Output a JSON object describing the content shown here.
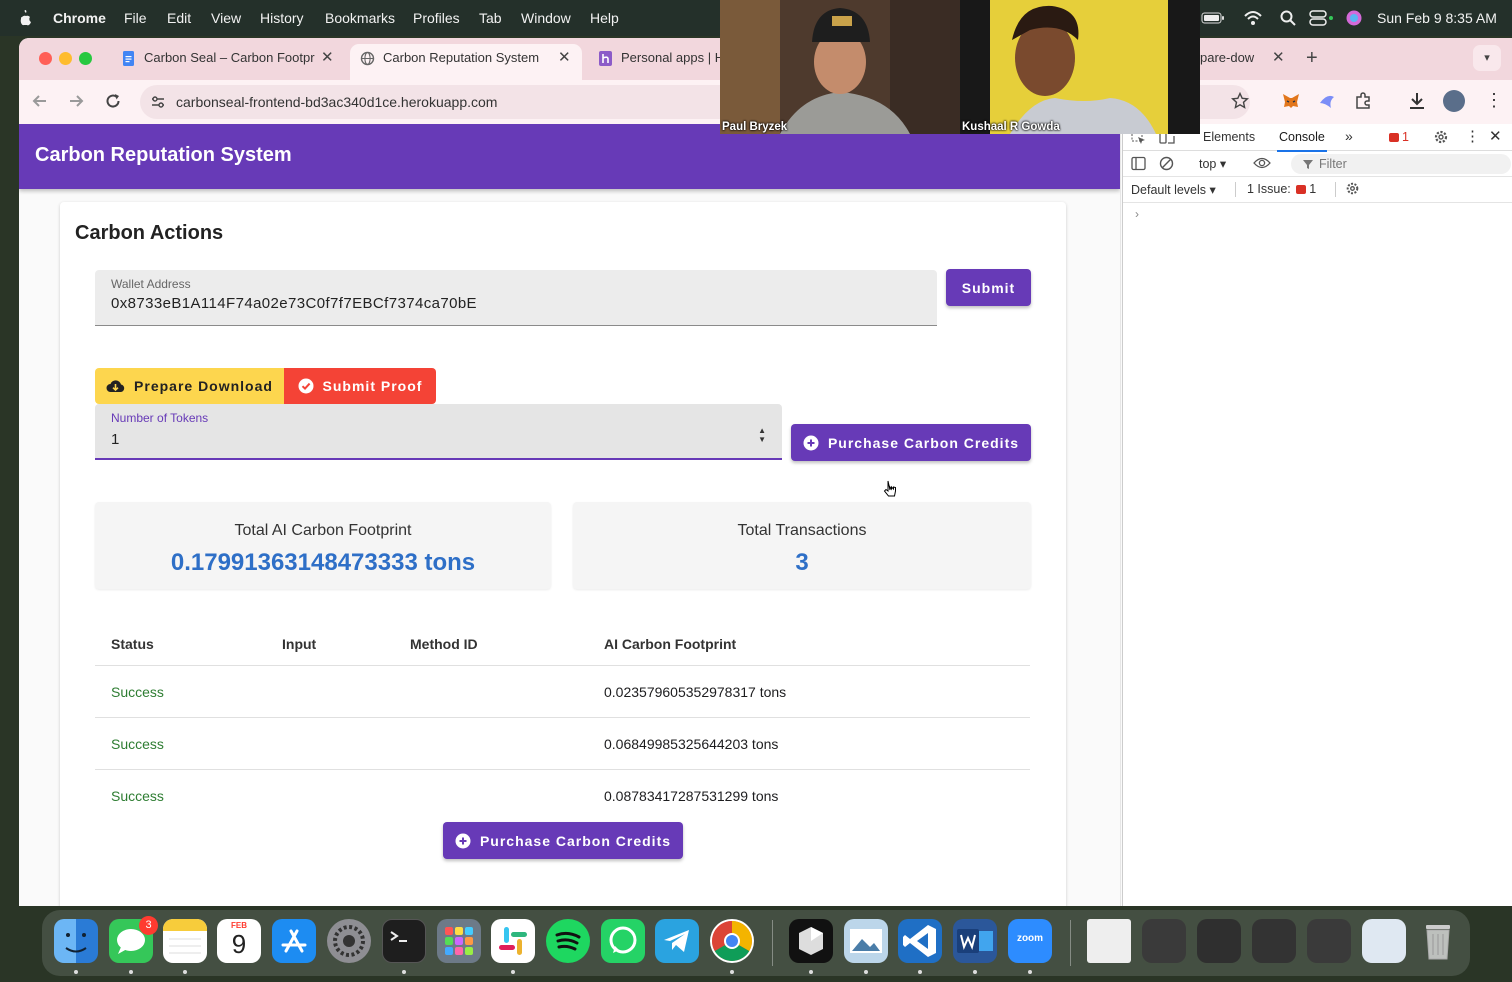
{
  "menubar": {
    "app": "Chrome",
    "items": [
      "File",
      "Edit",
      "View",
      "History",
      "Bookmarks",
      "Profiles",
      "Tab",
      "Window",
      "Help"
    ],
    "clock": "Sun Feb 9  8:35 AM"
  },
  "browser": {
    "tabs": [
      {
        "title": "Carbon Seal – Carbon Footpr",
        "active": false
      },
      {
        "title": "Carbon Reputation System",
        "active": true
      },
      {
        "title": "Personal apps | He",
        "active": false
      },
      {
        "title": "pare-dow",
        "active": false
      }
    ],
    "url": "carbonseal-frontend-bd3ac340d1ce.herokuapp.com"
  },
  "app": {
    "title": "Carbon Reputation System",
    "section_title": "Carbon Actions",
    "wallet": {
      "label": "Wallet Address",
      "value": "0x8733eB1A114F74a02e73C0f7f7EBCf7374ca70bE"
    },
    "submit_label": "Submit",
    "prepare_download_label": "Prepare Download",
    "submit_proof_label": "Submit Proof",
    "tokens": {
      "label": "Number of Tokens",
      "value": "1"
    },
    "purchase_label": "Purchase Carbon Credits",
    "stats": {
      "footprint_label": "Total AI Carbon Footprint",
      "footprint_value": "0.17991363148473333 tons",
      "transactions_label": "Total Transactions",
      "transactions_value": "3"
    },
    "table": {
      "headers": [
        "Status",
        "Input",
        "Method ID",
        "AI Carbon Footprint"
      ],
      "rows": [
        {
          "status": "Success",
          "input": "",
          "method_id": "",
          "footprint": "0.023579605352978317 tons"
        },
        {
          "status": "Success",
          "input": "",
          "method_id": "",
          "footprint": "0.06849985325644203 tons"
        },
        {
          "status": "Success",
          "input": "",
          "method_id": "",
          "footprint": "0.08783417287531299 tons"
        }
      ]
    },
    "bottom_purchase_label": "Purchase Carbon Credits"
  },
  "devtools": {
    "tabs": [
      "Elements",
      "Console"
    ],
    "error_count": "1",
    "context": "top",
    "filter_placeholder": "Filter",
    "levels": "Default levels",
    "issues_label": "1 Issue:",
    "issues_count": "1"
  },
  "video_call": {
    "participants": [
      "Paul Bryzek",
      "Kushaal R Gowda"
    ]
  },
  "dock": {
    "messages_badge": "3",
    "calendar": {
      "month": "FEB",
      "day": "9"
    },
    "zoom_label": "zoom"
  },
  "colors": {
    "primary": "#673ab7",
    "warning": "#fdd64e",
    "error": "#f44336",
    "success_text": "#2e7d32",
    "stat_value": "#2e6fc7"
  }
}
